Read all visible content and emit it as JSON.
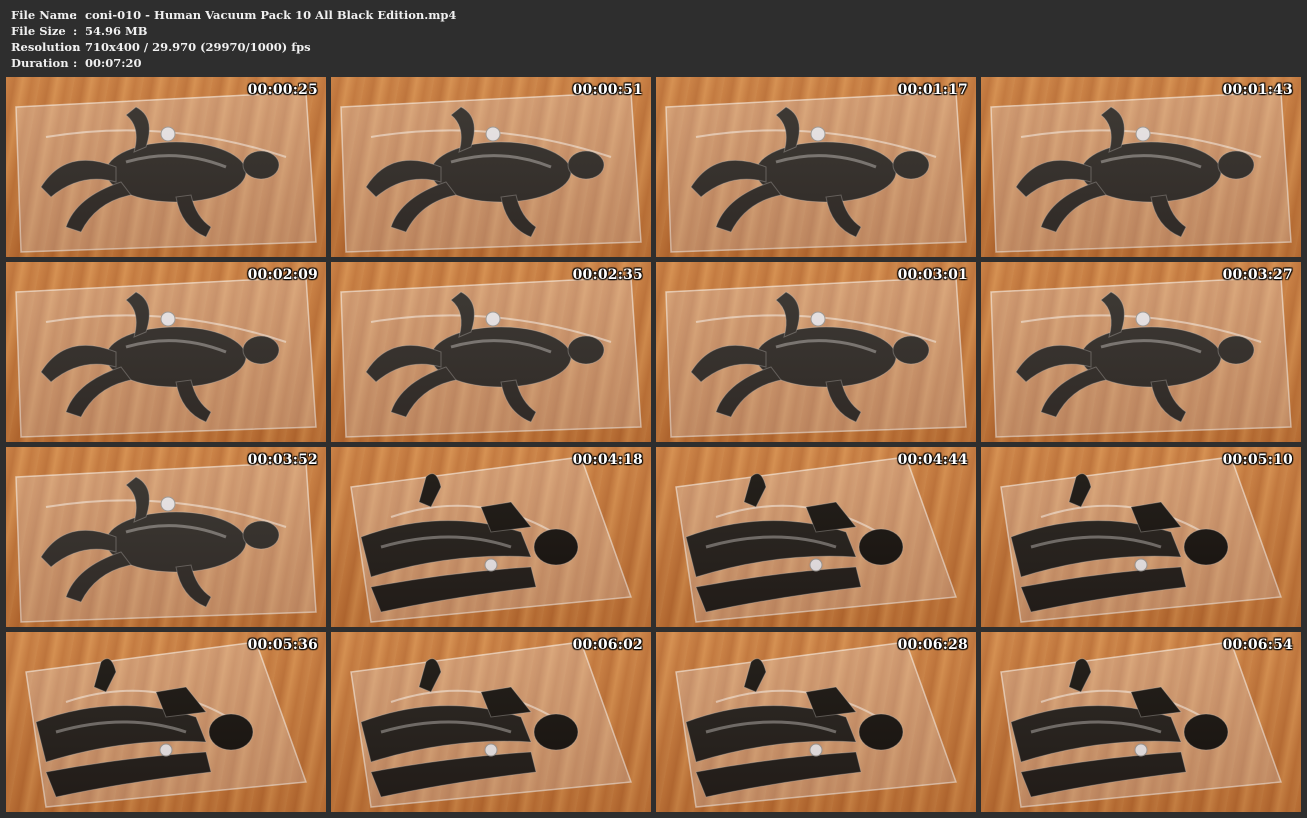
{
  "info": {
    "rows": [
      {
        "key": "File Name",
        "sep": ":",
        "value": "coni-010 - Human Vacuum Pack 10 All Black Edition.mp4"
      },
      {
        "key": "File Size",
        "sep": ":",
        "value": "54.96 MB"
      },
      {
        "key": "Resolution",
        "sep": ":",
        "value": "710x400 / 29.970 (29970/1000) fps"
      },
      {
        "key": "Duration",
        "sep": ":",
        "value": "00:07:20"
      }
    ]
  },
  "thumbnails": [
    {
      "timestamp": "00:00:25"
    },
    {
      "timestamp": "00:00:51"
    },
    {
      "timestamp": "00:01:17"
    },
    {
      "timestamp": "00:01:43"
    },
    {
      "timestamp": "00:02:09"
    },
    {
      "timestamp": "00:02:35"
    },
    {
      "timestamp": "00:03:01"
    },
    {
      "timestamp": "00:03:27"
    },
    {
      "timestamp": "00:03:52"
    },
    {
      "timestamp": "00:04:18"
    },
    {
      "timestamp": "00:04:44"
    },
    {
      "timestamp": "00:05:10"
    },
    {
      "timestamp": "00:05:36"
    },
    {
      "timestamp": "00:06:02"
    },
    {
      "timestamp": "00:06:28"
    },
    {
      "timestamp": "00:06:54"
    }
  ]
}
